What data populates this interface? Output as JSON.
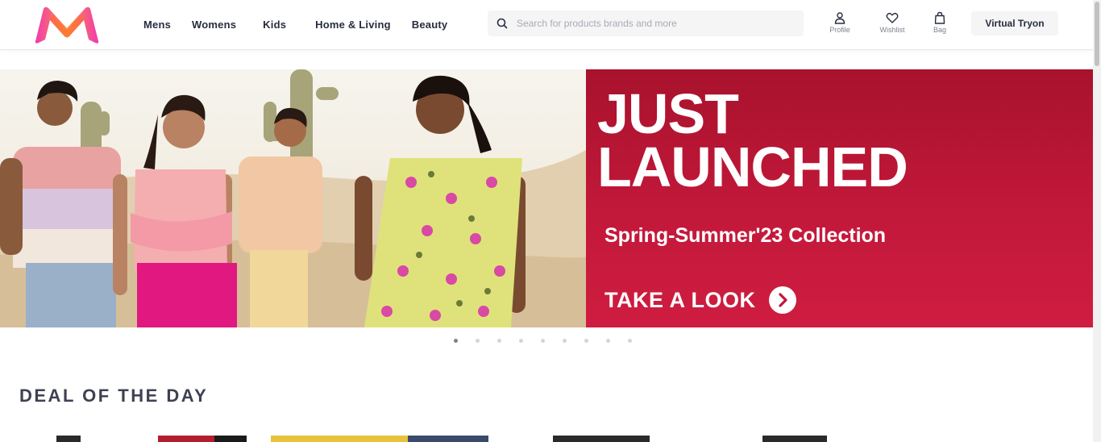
{
  "header": {
    "logo_alt": "Myntra",
    "nav": [
      "Mens",
      "Womens",
      "Kids",
      "Home & Living",
      "Beauty"
    ],
    "search": {
      "placeholder": "Search for products brands and more"
    },
    "actions": {
      "profile": "Profile",
      "wishlist": "Wishlist",
      "bag": "Bag"
    },
    "tryon_label": "Virtual Tryon"
  },
  "banner": {
    "headline_line1": "JUST",
    "headline_line2": "LAUNCHED",
    "subtitle": "Spring-Summer'23 Collection",
    "cta_label": "TAKE A LOOK",
    "bg_color": "#c2183a"
  },
  "carousel": {
    "dot_count": 9,
    "active_index": 0
  },
  "deal": {
    "title": "DEAL OF THE DAY"
  },
  "colors": {
    "brand_pink": "#ff3f6c",
    "brand_orange": "#f7a21b",
    "text": "#282c3f"
  }
}
